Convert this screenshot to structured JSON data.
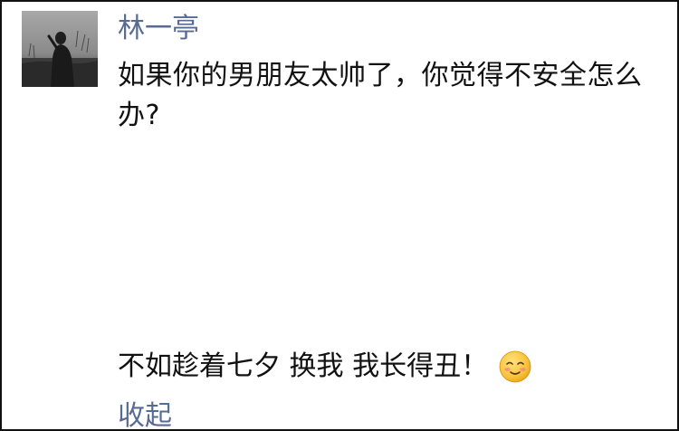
{
  "comment": {
    "author": "林一亭",
    "avatar_icon": "avatar-photo-silhouette",
    "text": "如果你的男朋友太帅了，你觉得不安全怎么办?",
    "reply_text": "不如趁着七夕 换我 我长得丑！",
    "reply_emoji": "blushing-smile-emoji",
    "collapse_label": "收起"
  },
  "colors": {
    "author_name": "#576b95",
    "body_text": "#111111",
    "link": "#576b95",
    "border": "#111111"
  }
}
